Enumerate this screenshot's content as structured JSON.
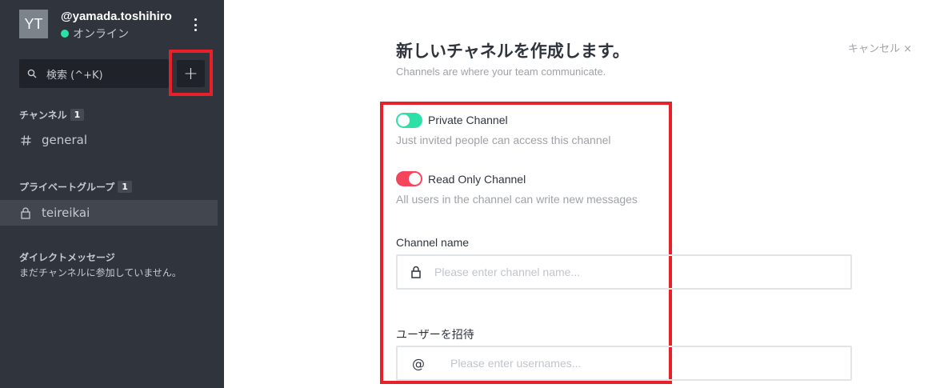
{
  "user": {
    "initials": "YT",
    "username": "@yamada.toshihiro",
    "status": "オンライン"
  },
  "search": {
    "placeholder": "検索 (^+K)"
  },
  "add_button": "+",
  "sections": {
    "channels": {
      "label": "チャンネル",
      "count": "1",
      "items": [
        {
          "name": "general"
        }
      ]
    },
    "private_groups": {
      "label": "プライベートグループ",
      "count": "1",
      "items": [
        {
          "name": "teireikai"
        }
      ]
    },
    "direct_messages": {
      "label": "ダイレクトメッセージ",
      "empty": "まだチャンネルに参加していません。"
    }
  },
  "create": {
    "title": "新しいチャネルを作成します。",
    "subtitle": "Channels are where your team communicate.",
    "cancel": "キャンセル ×",
    "private": {
      "label": "Private Channel",
      "desc": "Just invited people can access this channel",
      "on": false,
      "color": "#2de0a5"
    },
    "read_only": {
      "label": "Read Only Channel",
      "desc": "All users in the channel can write new messages",
      "on": true,
      "color": "#f5455c"
    },
    "channel_name": {
      "label": "Channel name",
      "placeholder": "Please enter channel name...",
      "value": ""
    },
    "invite": {
      "label": "ユーザーを招待",
      "placeholder": "Please enter usernames...",
      "value": ""
    }
  },
  "icons": {
    "kebab": "kebab-menu-icon",
    "search": "search-icon",
    "hash": "hash-icon",
    "lock": "lock-icon",
    "at": "at-icon"
  },
  "colors": {
    "sidebar_bg": "#2f343d",
    "highlight": "#e8202a",
    "online": "#2de0a5"
  }
}
